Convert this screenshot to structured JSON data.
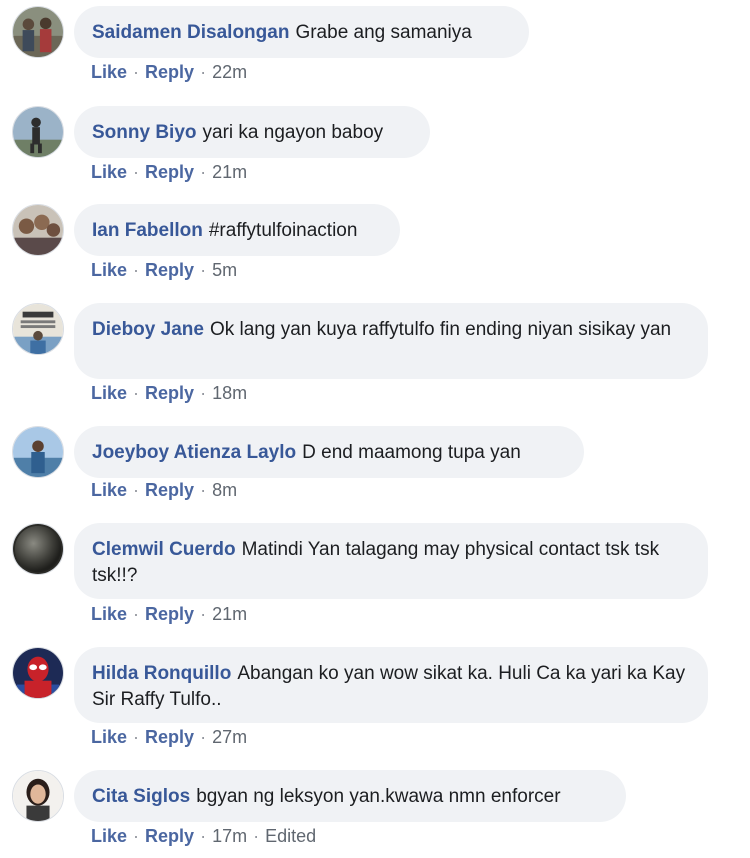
{
  "actions": {
    "like": "Like",
    "reply": "Reply",
    "separator": "·"
  },
  "comments": [
    {
      "author": "Saidamen Disalongan",
      "text": "Grabe ang samaniya",
      "time": "22m",
      "edited": ""
    },
    {
      "author": "Sonny Biyo",
      "text": "yari ka ngayon baboy",
      "time": "21m",
      "edited": ""
    },
    {
      "author": "Ian Fabellon",
      "text": "#raffytulfoinaction",
      "time": "5m",
      "edited": ""
    },
    {
      "author": "Dieboy Jane",
      "text": "Ok lang yan kuya raffytulfo fin ending niyan sisikay yan",
      "time": "18m",
      "edited": ""
    },
    {
      "author": "Joeyboy Atienza Laylo",
      "text": "D end maamong tupa yan",
      "time": "8m",
      "edited": ""
    },
    {
      "author": "Clemwil Cuerdo",
      "text": "Matindi Yan talagang may physical contact tsk tsk tsk!!?",
      "time": "21m",
      "edited": ""
    },
    {
      "author": "Hilda Ronquillo",
      "text": "Abangan ko yan wow sikat ka. Huli Ca ka yari ka Kay Sir Raffy Tulfo..",
      "time": "27m",
      "edited": ""
    },
    {
      "author": "Cita Siglos",
      "text": "bgyan ng leksyon yan.kwawa nmn enforcer",
      "time": "17m",
      "edited": "Edited"
    }
  ]
}
